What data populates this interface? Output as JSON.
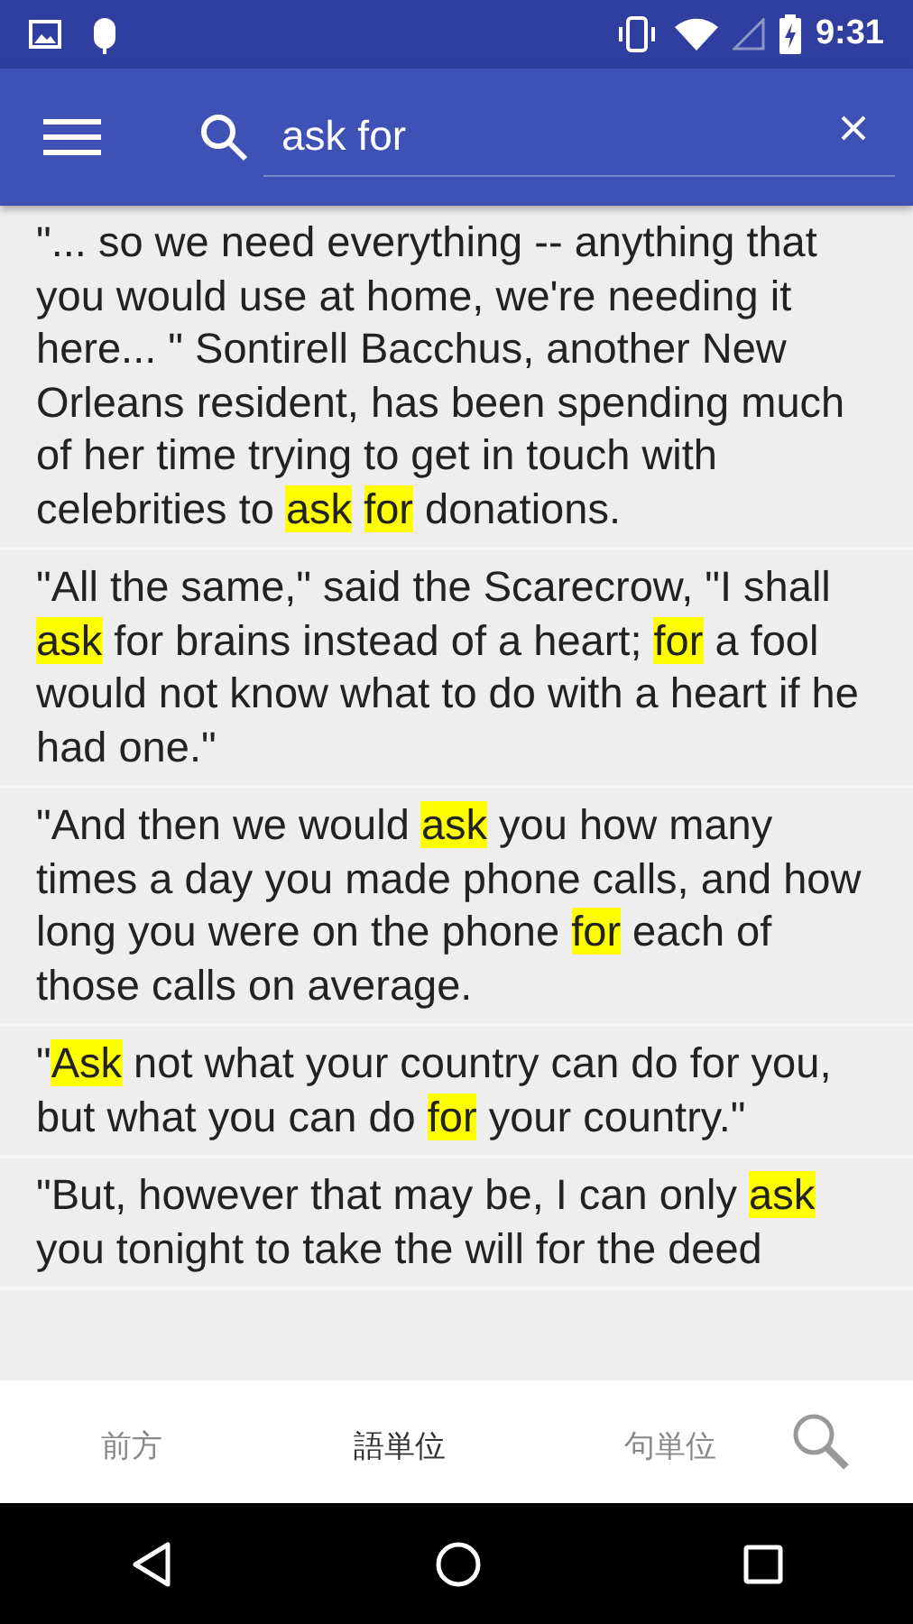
{
  "status_bar": {
    "time": "9:31"
  },
  "search": {
    "value": "ask for"
  },
  "results": [
    {
      "segments": [
        {
          "text": "\"... so we need everything -- anything that you would use at home, we're needing it here... \" Sontirell Bacchus, another New Orleans resident, has been spending much of her time trying to get in touch with celebrities to ",
          "highlighted": false
        },
        {
          "text": "ask ",
          "highlighted": true
        },
        {
          "text": "for",
          "highlighted": true
        },
        {
          "text": " donations.",
          "highlighted": false
        }
      ]
    },
    {
      "segments": [
        {
          "text": "\"All the same,\" said the Scarecrow, \"I shall ",
          "highlighted": false
        },
        {
          "text": "ask",
          "highlighted": true
        },
        {
          "text": " for brains instead of a heart; ",
          "highlighted": false
        },
        {
          "text": "for",
          "highlighted": true
        },
        {
          "text": " a fool would not know what to do with a heart if he had one.\"",
          "highlighted": false
        }
      ]
    },
    {
      "segments": [
        {
          "text": "\"And then we would ",
          "highlighted": false
        },
        {
          "text": "ask",
          "highlighted": true
        },
        {
          "text": " you how many times a day you made phone calls, and how long you were on the phone ",
          "highlighted": false
        },
        {
          "text": "for",
          "highlighted": true
        },
        {
          "text": " each of those calls on average.",
          "highlighted": false
        }
      ]
    },
    {
      "segments": [
        {
          "text": "\"",
          "highlighted": false
        },
        {
          "text": "Ask",
          "highlighted": true
        },
        {
          "text": " not what your country can do for you, but what you can do ",
          "highlighted": false
        },
        {
          "text": "for",
          "highlighted": true
        },
        {
          "text": " your country.\"",
          "highlighted": false
        }
      ]
    },
    {
      "segments": [
        {
          "text": "\"But, however that may be, I can only ",
          "highlighted": false
        },
        {
          "text": "ask",
          "highlighted": true
        },
        {
          "text": " you tonight to take the will for the deed",
          "highlighted": false
        }
      ]
    }
  ],
  "bottom_tabs": [
    {
      "label": "前方",
      "selected": false
    },
    {
      "label": "語単位",
      "selected": true
    },
    {
      "label": "句単位",
      "selected": false
    }
  ]
}
